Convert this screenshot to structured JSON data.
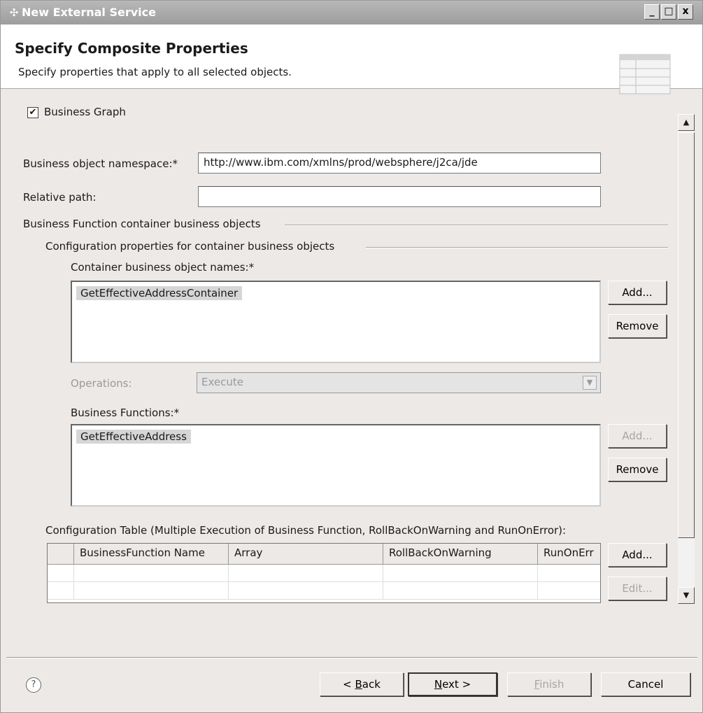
{
  "window": {
    "title": "New External Service",
    "buttons": {
      "minimize": "_",
      "maximize": "□",
      "close": "x"
    }
  },
  "header": {
    "title": "Specify Composite Properties",
    "description": "Specify properties that apply to all selected objects."
  },
  "form": {
    "business_graph": {
      "label": "Business Graph",
      "checked": true
    },
    "namespace": {
      "label": "Business object namespace:*",
      "value": "http://www.ibm.com/xmlns/prod/websphere/j2ca/jde"
    },
    "relative_path": {
      "label": "Relative path:",
      "value": ""
    },
    "group_bf_container": "Business Function container business objects",
    "group_config_props": "Configuration properties for container business objects",
    "container_names": {
      "label": "Container business object names:*",
      "items": [
        "GetEffectiveAddressContainer"
      ],
      "add": "Add...",
      "remove": "Remove"
    },
    "operations": {
      "label": "Operations:",
      "value": "Execute"
    },
    "business_functions": {
      "label": "Business Functions:*",
      "items": [
        "GetEffectiveAddress"
      ],
      "add": "Add...",
      "remove": "Remove"
    },
    "config_table": {
      "label": "Configuration Table (Multiple Execution of Business Function, RollBackOnWarning and RunOnError):",
      "columns": [
        "",
        "BusinessFunction Name",
        "Array",
        "RollBackOnWarning",
        "RunOnErr"
      ],
      "add": "Add...",
      "edit": "Edit..."
    }
  },
  "footer": {
    "help": "?",
    "back_pre": "< ",
    "back_u": "B",
    "back_post": "ack",
    "next_u": "N",
    "next_post": "ext >",
    "finish_u": "F",
    "finish_post": "inish",
    "cancel": "Cancel"
  },
  "colors": {
    "title_bar": "#a9a9a9",
    "dialog_bg": "#ece9e6",
    "selection": "#d6d6d6"
  }
}
